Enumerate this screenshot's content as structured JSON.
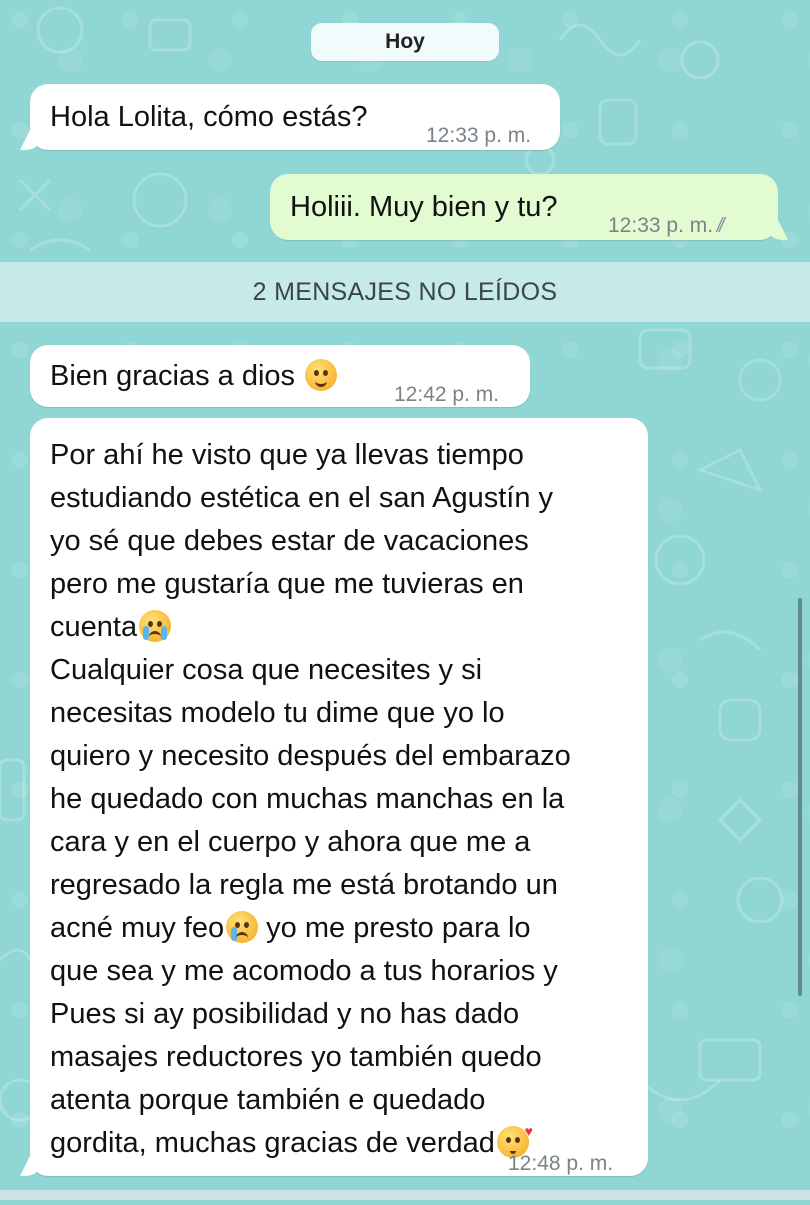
{
  "chat": {
    "date_chip": "Hoy",
    "unread_divider": "2 MENSAJES NO LEÍDOS",
    "messages": [
      {
        "direction": "incoming",
        "text": "Hola Lolita, cómo estás?",
        "time": "12:33 p. m."
      },
      {
        "direction": "outgoing",
        "text": "Holiii. Muy bien y tu?",
        "time": "12:33 p. m.",
        "status_icon": "double-check-read"
      },
      {
        "direction": "incoming",
        "text": "Bien gracias a dios",
        "emoji": "hugging-face",
        "time": "12:42 p. m."
      },
      {
        "direction": "incoming",
        "lines": [
          "Por ahí he visto que ya llevas tiempo",
          "estudiando estética en el san Agustín y",
          "yo sé que debes estar de vacaciones",
          "pero me gustaría que me tuvieras en",
          "cuenta",
          "Cualquier cosa que necesites y si",
          "necesitas modelo tu dime que yo lo",
          "quiero y necesito después del embarazo",
          "he quedado con muchas manchas en la",
          "cara y en el cuerpo y ahora que me a",
          "regresado la regla me está brotando un",
          "acné muy feo",
          " yo me presto para lo",
          "que sea y me acomodo a tus horarios y",
          "Pues si ay posibilidad y no has dado",
          "masajes reductores yo también quedo",
          "atenta porque también e quedado",
          "gordita, muchas gracias de verdad"
        ],
        "emojis": [
          "loudly-crying-face",
          "crying-face",
          "face-blowing-kiss"
        ],
        "time": "12:48 p. m."
      }
    ]
  },
  "colors": {
    "wallpaper": "#8fd6d4",
    "incoming_bubble": "#ffffff",
    "outgoing_bubble": "#e2fbd0",
    "timestamp": "#7a8388"
  }
}
